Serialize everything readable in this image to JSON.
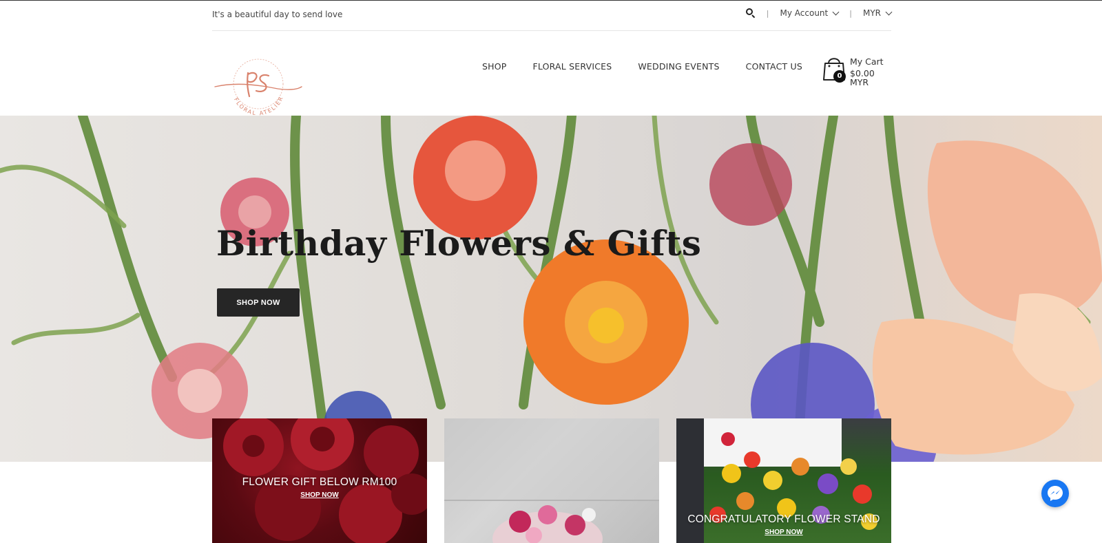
{
  "topbar": {
    "tagline": "It's a beautiful day to send love",
    "account_label": "My Account",
    "currency_label": "MYR",
    "separator": "|"
  },
  "header": {
    "logo_icon": "ps-floral-atelier-logo",
    "logo_text": "FLORAL ATELIER",
    "nav": [
      "SHOP",
      "FLORAL SERVICES",
      "WEDDING EVENTS",
      "CONTACT US"
    ],
    "cart": {
      "label": "My Cart",
      "count": "0",
      "amount": "$0.00 MYR"
    }
  },
  "hero": {
    "title": "Birthday Flowers & Gifts",
    "button": "SHOP NOW"
  },
  "cards": [
    {
      "title": "FLOWER GIFT BELOW RM100",
      "link": "SHOP NOW"
    },
    {
      "title": "",
      "link": ""
    },
    {
      "title": "CONGRATULATORY FLOWER STAND",
      "link": "SHOP NOW"
    }
  ],
  "colors": {
    "logo_accent": "#e0907a",
    "button_bg": "#262626",
    "messenger": "#1877f2"
  }
}
